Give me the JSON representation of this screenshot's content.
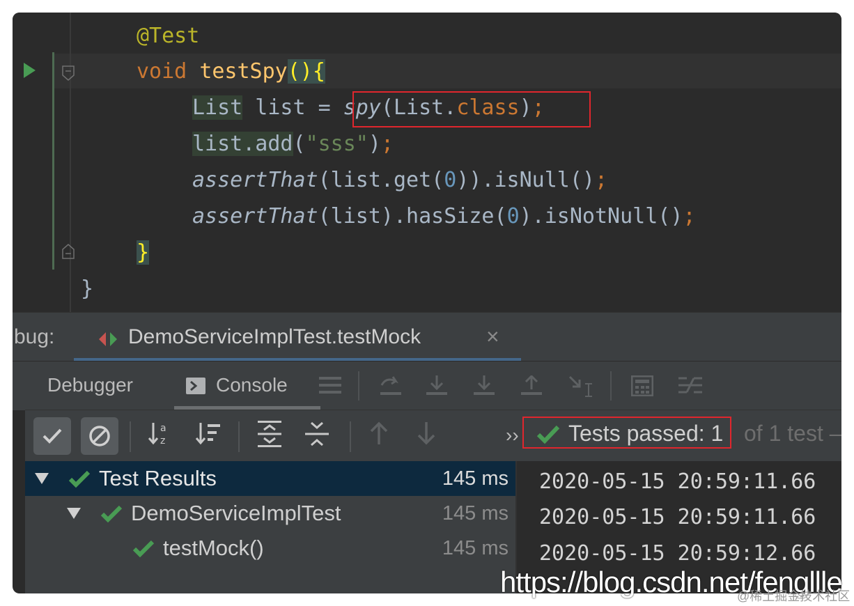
{
  "editor": {
    "lines": {
      "annotation": "@Test",
      "method_kw": "void",
      "method_name": "testSpy",
      "method_parens": "()",
      "method_brace": "{",
      "l3_type": "List",
      "l3_var": " list = ",
      "l3_spy": "spy",
      "l3_arg_open": "(List.",
      "l3_class_kw": "class",
      "l3_arg_close": ")",
      "l3_semi": ";",
      "l4_call": "list.add",
      "l4_open": "(",
      "l4_str": "\"sss\"",
      "l4_close": ")",
      "l4_semi": ";",
      "l5_assert": "assertThat",
      "l5_mid": "(list.get(",
      "l5_num": "0",
      "l5_tail": ")).isNull()",
      "l5_semi": ";",
      "l6_assert": "assertThat",
      "l6_mid": "(list).hasSize(",
      "l6_num": "0",
      "l6_tail": ").isNotNull()",
      "l6_semi": ";",
      "close_method": "}",
      "close_class": "}"
    }
  },
  "debug": {
    "label": "bug:",
    "tab_title": "DemoServiceImplTest.testMock",
    "close_glyph": "×",
    "subtabs": {
      "debugger": "Debugger",
      "console": "Console"
    }
  },
  "test_toolbar": {
    "more_glyph": "››",
    "status_passed": "Tests passed: 1",
    "status_rest": "of 1 test –"
  },
  "tree": {
    "rows": [
      {
        "label": "Test Results",
        "time": "145 ms"
      },
      {
        "label": "DemoServiceImplTest",
        "time": "145 ms"
      },
      {
        "label": "testMock()",
        "time": "145 ms"
      }
    ]
  },
  "console": {
    "lines": [
      "2020-05-15 20:59:11.66",
      "2020-05-15 20:59:11.66",
      "2020-05-15 20:59:12.66"
    ]
  },
  "watermark": {
    "url": "https://blog.csdn.net/fengllle",
    "community": "@稀土掘金技术社区"
  },
  "colors": {
    "accent_green": "#499c54",
    "highlight_red": "#e0262d",
    "selection": "#0d293e"
  }
}
